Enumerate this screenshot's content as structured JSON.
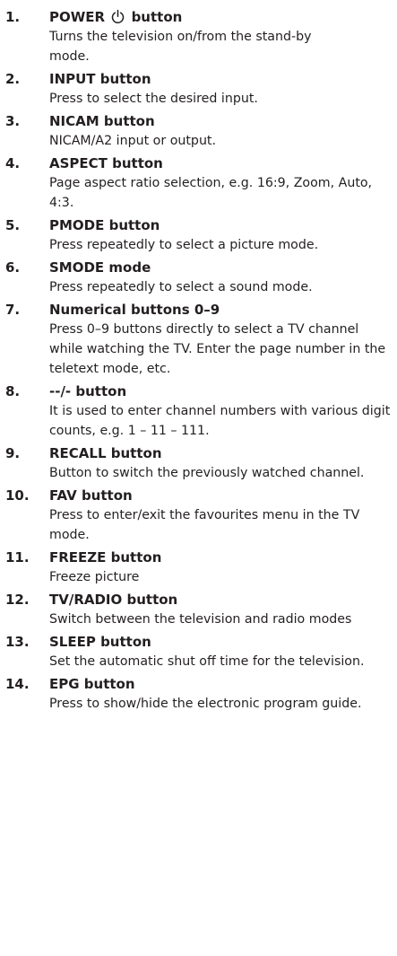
{
  "items": [
    {
      "num": "1.",
      "title_before": "POWER",
      "title_after": "button",
      "desc": "Turns the television on/from the stand-by mode."
    },
    {
      "num": "2.",
      "title": "INPUT button",
      "desc": "Press to select the desired input."
    },
    {
      "num": "3.",
      "title": "NICAM button",
      "desc": "NICAM/A2 input or output."
    },
    {
      "num": "4.",
      "title": "ASPECT button",
      "desc": "Page aspect ratio selection, e.g. 16:9, Zoom, Auto, 4:3."
    },
    {
      "num": "5.",
      "title": "PMODE button",
      "desc": "Press repeatedly to select a picture mode."
    },
    {
      "num": "6.",
      "title": "SMODE mode",
      "desc": "Press repeatedly to select a sound mode."
    },
    {
      "num": "7.",
      "title": "Numerical buttons 0–9",
      "desc": "Press 0–9 buttons directly to select a TV channel while watching the TV. Enter the page number in the teletext mode, etc."
    },
    {
      "num": "8.",
      "title": "--/- button",
      "desc": "It is used to enter channel numbers with various digit counts, e.g. 1 – 11 – 111."
    },
    {
      "num": "9.",
      "title": "RECALL button",
      "desc": "Button to switch the previously watched channel."
    },
    {
      "num": "10.",
      "title": "FAV button",
      "desc": "Press to enter/exit the favourites menu in the TV mode."
    },
    {
      "num": "11.",
      "title": "FREEZE button",
      "desc": "Freeze picture"
    },
    {
      "num": "12.",
      "title": "TV/RADIO button",
      "desc": "Switch between the television and radio modes"
    },
    {
      "num": "13.",
      "title": "SLEEP button",
      "desc": "Set the automatic shut off time for the television."
    },
    {
      "num": "14.",
      "title": "EPG button",
      "desc": "Press to show/hide the electronic program guide."
    }
  ],
  "icons": {
    "power": "power-symbol-icon"
  }
}
